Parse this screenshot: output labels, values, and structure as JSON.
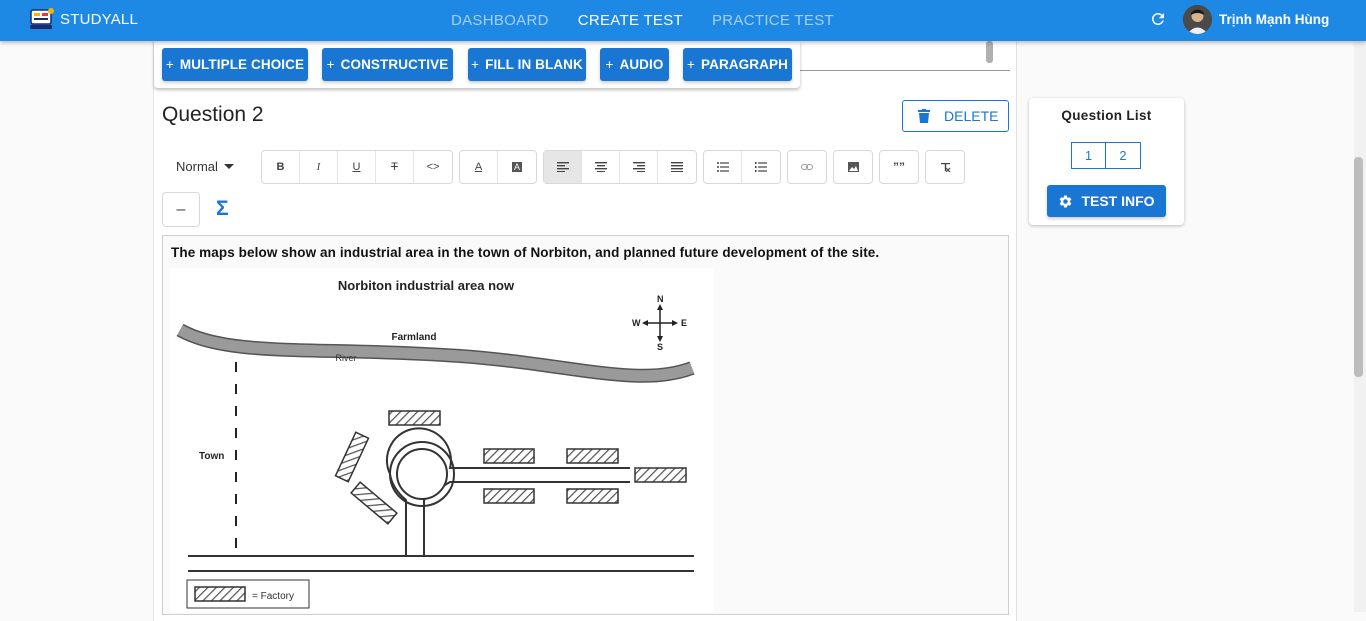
{
  "app": {
    "brand": "STUDYALL"
  },
  "nav": {
    "items": [
      "DASHBOARD",
      "CREATE TEST",
      "PRACTICE TEST"
    ],
    "active": "CREATE TEST"
  },
  "user": {
    "name": "Trịnh Mạnh Hùng"
  },
  "add_bar": {
    "multiple_choice": "MULTIPLE CHOICE",
    "constructive": "CONSTRUCTIVE",
    "fill_in_blank": "FILL IN BLANK",
    "audio": "AUDIO",
    "paragraph": "PARAGRAPH",
    "plus": "+"
  },
  "question": {
    "title": "Question 2",
    "delete_label": "DELETE",
    "prompt": "The maps below show an industrial area in the town of Norbiton, and planned future development of the site."
  },
  "toolbar": {
    "header_select": "Normal",
    "bold": "B",
    "italic": "I",
    "underline": "U",
    "strike": "T",
    "code": "<>",
    "font_color": "A",
    "background": "A",
    "blockquote": "””",
    "horizontal_rule": "–",
    "formula": "Σ"
  },
  "map": {
    "title": "Norbiton industrial area now",
    "farmland": "Farmland",
    "river": "River",
    "town": "Town",
    "legend": "= Factory",
    "compass": {
      "n": "N",
      "s": "S",
      "e": "E",
      "w": "W"
    }
  },
  "question_list": {
    "title": "Question List",
    "numbers": [
      "1",
      "2"
    ],
    "test_info": "TEST INFO"
  },
  "colors": {
    "primary": "#1976d2",
    "topbar": "#1e88e5"
  }
}
